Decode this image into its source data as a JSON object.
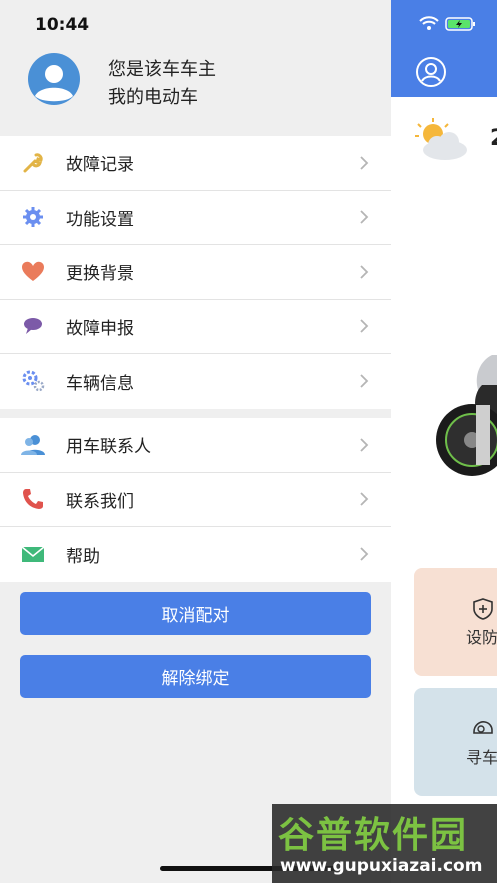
{
  "status_bar": {
    "time": "10:44"
  },
  "drawer": {
    "owner_line1": "您是该车车主",
    "owner_line2": "我的电动车",
    "group1": [
      {
        "label": "故障记录",
        "icon": "wrench-icon"
      },
      {
        "label": "功能设置",
        "icon": "gear-icon"
      },
      {
        "label": "更换背景",
        "icon": "heart-icon"
      },
      {
        "label": "故障申报",
        "icon": "speech-bubble-icon"
      },
      {
        "label": "车辆信息",
        "icon": "gears-icon"
      }
    ],
    "group2": [
      {
        "label": "用车联系人",
        "icon": "contacts-icon"
      },
      {
        "label": "联系我们",
        "icon": "phone-icon"
      },
      {
        "label": "帮助",
        "icon": "envelope-icon"
      }
    ],
    "unpair_label": "取消配对",
    "unbind_label": "解除绑定"
  },
  "background_app": {
    "temperature_partial": "2",
    "arm_label_partial": "设防",
    "find_label_partial": "寻车"
  },
  "watermark": {
    "title": "谷普软件园",
    "url": "www.gupuxiazai.com"
  },
  "colors": {
    "accent": "#4a7fe6",
    "drawer_bg": "#efefef",
    "arm_card": "#f7e0d3",
    "find_card": "#d4e2ea"
  }
}
